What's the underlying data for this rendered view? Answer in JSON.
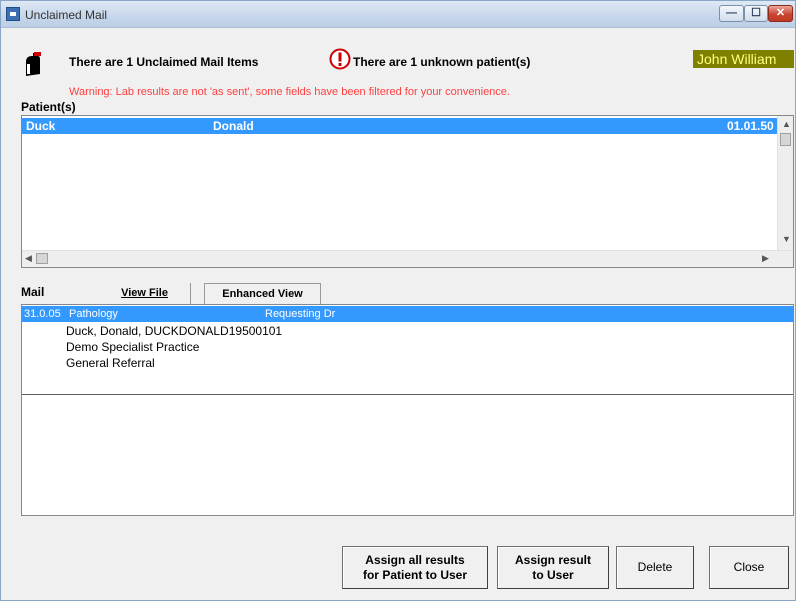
{
  "window": {
    "title": "Unclaimed Mail",
    "min_glyph": "—",
    "max_glyph": "☐",
    "close_glyph": "✕"
  },
  "header": {
    "unclaimed_text": "There are 1 Unclaimed Mail Items",
    "unknown_text": "There are 1 unknown patient(s)",
    "user_name": "John William",
    "warning": "Warning: Lab results are not 'as sent', some fields have been filtered for your convenience."
  },
  "patients": {
    "label": "Patient(s)",
    "rows": [
      {
        "surname": "Duck",
        "given": "Donald",
        "dob": "01.01.50"
      }
    ]
  },
  "mail": {
    "label": "Mail",
    "tabs": {
      "view_file": "View File",
      "enhanced_view": "Enhanced View"
    },
    "selected_row": {
      "date": "31.0.05",
      "type": "Pathology",
      "requesting": "Requesting Dr"
    },
    "details": [
      "Duck, Donald, DUCKDONALD19500101",
      "Demo Specialist Practice",
      "General Referral"
    ]
  },
  "buttons": {
    "assign_all_line1": "Assign all results",
    "assign_all_line2": "for Patient to User",
    "assign_result_line1": "Assign result",
    "assign_result_line2": "to User",
    "delete": "Delete",
    "close": "Close"
  },
  "icons": [
    "mail-icon",
    "alert-icon"
  ],
  "colors": {
    "selection": "#3399ff",
    "warning": "#ff4040",
    "user_badge_bg": "#808000",
    "user_badge_fg": "#ffff80"
  }
}
